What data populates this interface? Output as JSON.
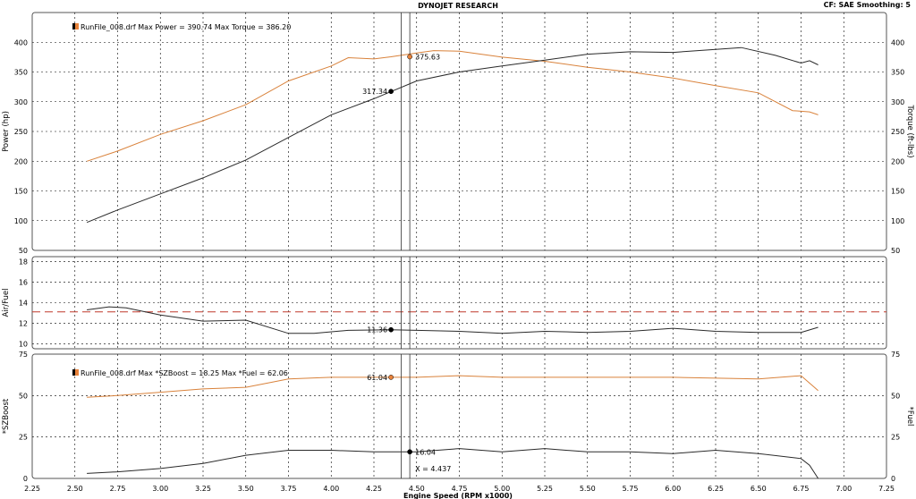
{
  "header": {
    "title": "DYNOJET RESEARCH",
    "settings": "CF: SAE   Smoothing: 5"
  },
  "xaxis": {
    "label": "Engine Speed (RPM x1000)",
    "ticks": [
      "2.25",
      "2.50",
      "2.75",
      "3.00",
      "3.25",
      "3.50",
      "3.75",
      "4.00",
      "4.25",
      "4.50",
      "4.75",
      "5.00",
      "5.25",
      "5.50",
      "5.75",
      "6.00",
      "6.25",
      "6.50",
      "6.75",
      "7.00",
      "7.25"
    ],
    "range": [
      2.25,
      7.25
    ]
  },
  "panels": {
    "power": {
      "ylabel_left": "Power (hp)",
      "ylabel_right": "Torque (ft-lbs)",
      "yticks": [
        "50",
        "100",
        "150",
        "200",
        "250",
        "300",
        "350",
        "400"
      ],
      "legend_file": "RunFile_008.drf",
      "legend_text": "RunFile_008.drf Max Power = 390.74    Max Torque = 386.20",
      "markers": {
        "power_value": "317.34",
        "torque_value": "375.63"
      }
    },
    "afr": {
      "ylabel_left": "Air/Fuel",
      "yticks": [
        "10",
        "12",
        "14",
        "16",
        "18"
      ],
      "marker_value": "11.36"
    },
    "boost": {
      "ylabel_left": "*SZBoost",
      "ylabel_right": "*Fuel",
      "yticks": [
        "0",
        "25",
        "50",
        "75"
      ],
      "legend_text": "RunFile_008.drf Max *SZBoost = 18.25    Max *Fuel = 62.06",
      "markers": {
        "fuel_value": "61.04",
        "boost_value": "16.04",
        "cursor_x": "X = 4.437"
      }
    }
  },
  "colors": {
    "torque": "#d9823b",
    "power": "#2a2a2a",
    "afr_target": "#c0392b",
    "grid": "#000000",
    "marker_orange": "#e8823a"
  },
  "chart_data": [
    {
      "type": "line",
      "title": "",
      "xlabel": "Engine Speed (RPM x1000)",
      "ylabel": "Power (hp)",
      "ylim": [
        50,
        450
      ],
      "series": [
        {
          "name": "Power",
          "x": [
            2.57,
            2.75,
            3.0,
            3.25,
            3.5,
            3.75,
            4.0,
            4.25,
            4.35,
            4.5,
            4.75,
            5.0,
            5.25,
            5.5,
            5.75,
            6.0,
            6.25,
            6.4,
            6.6,
            6.75,
            6.8,
            6.85
          ],
          "values": [
            97,
            118,
            145,
            172,
            202,
            240,
            278,
            305,
            317,
            335,
            350,
            360,
            370,
            380,
            384,
            383,
            388,
            391,
            378,
            365,
            369,
            362
          ]
        },
        {
          "name": "Torque",
          "x": [
            2.57,
            2.75,
            3.0,
            3.25,
            3.5,
            3.75,
            4.0,
            4.1,
            4.25,
            4.35,
            4.5,
            4.6,
            4.75,
            5.0,
            5.25,
            5.5,
            5.75,
            6.0,
            6.25,
            6.5,
            6.7,
            6.8,
            6.85
          ],
          "values": [
            200,
            217,
            245,
            268,
            295,
            335,
            360,
            374,
            372,
            375.63,
            382,
            386,
            385,
            375,
            368,
            358,
            350,
            340,
            327,
            315,
            285,
            283,
            278
          ]
        }
      ]
    },
    {
      "type": "line",
      "title": "",
      "xlabel": "Engine Speed (RPM x1000)",
      "ylabel": "Air/Fuel",
      "ylim": [
        9.5,
        18.5
      ],
      "series": [
        {
          "name": "Air/Fuel",
          "x": [
            2.57,
            2.7,
            2.8,
            3.0,
            3.25,
            3.5,
            3.75,
            3.9,
            4.1,
            4.35,
            4.5,
            4.75,
            5.0,
            5.25,
            5.5,
            5.75,
            6.0,
            6.25,
            6.5,
            6.75,
            6.85
          ],
          "values": [
            13.3,
            13.6,
            13.5,
            12.8,
            12.2,
            12.3,
            11.0,
            11.0,
            11.3,
            11.36,
            11.3,
            11.2,
            11.0,
            11.2,
            11.1,
            11.2,
            11.5,
            11.2,
            11.1,
            11.1,
            11.6
          ]
        },
        {
          "name": "Target",
          "x": [
            2.25,
            7.25
          ],
          "values": [
            13.1,
            13.1
          ]
        }
      ]
    },
    {
      "type": "line",
      "title": "",
      "xlabel": "Engine Speed (RPM x1000)",
      "ylabel": "*SZBoost",
      "ylim": [
        0,
        75
      ],
      "series": [
        {
          "name": "*Fuel",
          "x": [
            2.57,
            2.75,
            3.0,
            3.25,
            3.5,
            3.75,
            4.0,
            4.35,
            4.5,
            4.75,
            5.0,
            5.5,
            6.0,
            6.5,
            6.75,
            6.85
          ],
          "values": [
            49,
            50,
            52,
            54,
            55,
            60,
            61,
            61.04,
            61,
            62,
            61,
            61,
            61,
            60,
            62,
            53
          ]
        },
        {
          "name": "*SZBoost",
          "x": [
            2.57,
            2.75,
            3.0,
            3.25,
            3.5,
            3.75,
            4.0,
            4.25,
            4.5,
            4.75,
            5.0,
            5.25,
            5.5,
            5.75,
            6.0,
            6.25,
            6.5,
            6.75,
            6.8,
            6.85
          ],
          "values": [
            3,
            4,
            6,
            9,
            14,
            17,
            17,
            16,
            16.04,
            18,
            16,
            18,
            16,
            16,
            15,
            17,
            15,
            12,
            8,
            0
          ]
        }
      ]
    }
  ]
}
